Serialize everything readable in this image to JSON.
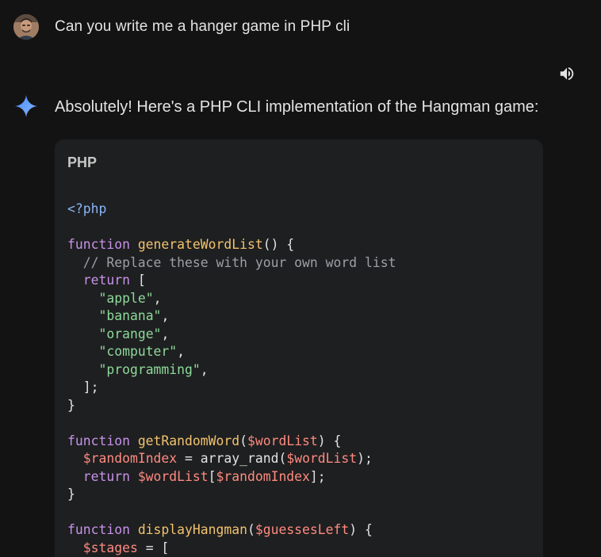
{
  "user": {
    "message": "Can you write me a hanger game in PHP cli"
  },
  "model": {
    "intro": "Absolutely! Here's a PHP CLI implementation of the Hangman game:"
  },
  "code_block": {
    "language": "PHP",
    "lines": [
      [
        {
          "t": "<?php",
          "c": "php"
        }
      ],
      [],
      [
        {
          "t": "function ",
          "c": "kw"
        },
        {
          "t": "generateWordList",
          "c": "fn"
        },
        {
          "t": "() {",
          "c": "plain"
        }
      ],
      [
        {
          "t": "  // Replace these with your own word list",
          "c": "cmt"
        }
      ],
      [
        {
          "t": "  return",
          "c": "kw"
        },
        {
          "t": " [",
          "c": "plain"
        }
      ],
      [
        {
          "t": "    ",
          "c": "plain"
        },
        {
          "t": "\"apple\"",
          "c": "str"
        },
        {
          "t": ",",
          "c": "plain"
        }
      ],
      [
        {
          "t": "    ",
          "c": "plain"
        },
        {
          "t": "\"banana\"",
          "c": "str"
        },
        {
          "t": ",",
          "c": "plain"
        }
      ],
      [
        {
          "t": "    ",
          "c": "plain"
        },
        {
          "t": "\"orange\"",
          "c": "str"
        },
        {
          "t": ",",
          "c": "plain"
        }
      ],
      [
        {
          "t": "    ",
          "c": "plain"
        },
        {
          "t": "\"computer\"",
          "c": "str"
        },
        {
          "t": ",",
          "c": "plain"
        }
      ],
      [
        {
          "t": "    ",
          "c": "plain"
        },
        {
          "t": "\"programming\"",
          "c": "str"
        },
        {
          "t": ",",
          "c": "plain"
        }
      ],
      [
        {
          "t": "  ];",
          "c": "plain"
        }
      ],
      [
        {
          "t": "}",
          "c": "plain"
        }
      ],
      [],
      [
        {
          "t": "function ",
          "c": "kw"
        },
        {
          "t": "getRandomWord",
          "c": "fn"
        },
        {
          "t": "(",
          "c": "plain"
        },
        {
          "t": "$wordList",
          "c": "var"
        },
        {
          "t": ") {",
          "c": "plain"
        }
      ],
      [
        {
          "t": "  ",
          "c": "plain"
        },
        {
          "t": "$randomIndex",
          "c": "var"
        },
        {
          "t": " = array_rand(",
          "c": "plain"
        },
        {
          "t": "$wordList",
          "c": "var"
        },
        {
          "t": ");",
          "c": "plain"
        }
      ],
      [
        {
          "t": "  return ",
          "c": "kw"
        },
        {
          "t": "$wordList",
          "c": "var"
        },
        {
          "t": "[",
          "c": "plain"
        },
        {
          "t": "$randomIndex",
          "c": "var"
        },
        {
          "t": "];",
          "c": "plain"
        }
      ],
      [
        {
          "t": "}",
          "c": "plain"
        }
      ],
      [],
      [
        {
          "t": "function ",
          "c": "kw"
        },
        {
          "t": "displayHangman",
          "c": "fn"
        },
        {
          "t": "(",
          "c": "plain"
        },
        {
          "t": "$guessesLeft",
          "c": "var"
        },
        {
          "t": ") {",
          "c": "plain"
        }
      ],
      [
        {
          "t": "  ",
          "c": "plain"
        },
        {
          "t": "$stages",
          "c": "var"
        },
        {
          "t": " = [",
          "c": "plain"
        }
      ]
    ]
  },
  "icons": {
    "user_avatar": "avatar",
    "speaker": "speaker-icon",
    "model_logo": "gemini-spark-icon"
  },
  "colors": {
    "background": "#131314",
    "code_background": "#1e1f20",
    "keyword": "#c792ea",
    "function": "#f1c26e",
    "variable": "#ff8a80",
    "string": "#8dd99a",
    "comment": "#9aa0a6",
    "php_tag": "#8ab4f8"
  }
}
